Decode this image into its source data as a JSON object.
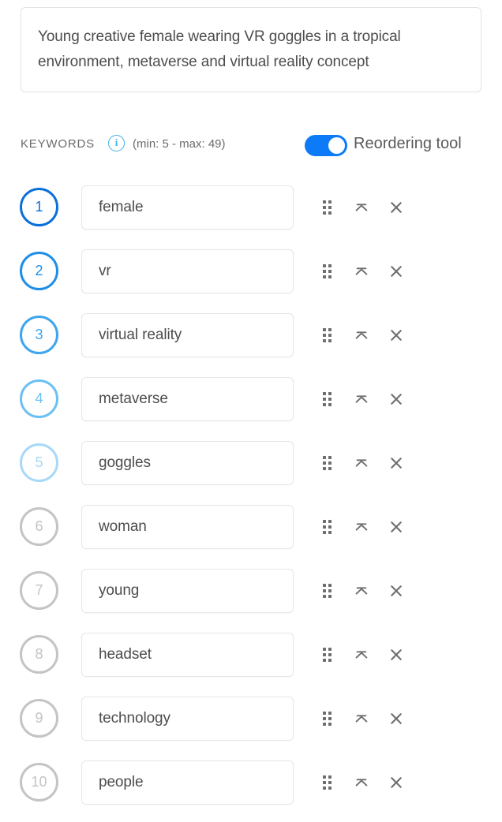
{
  "description": {
    "value": "Young creative female wearing VR goggles in a tropical environment, metaverse and virtual reality concept",
    "placeholder": "Enter description"
  },
  "keywords_header": {
    "label": "KEYWORDS",
    "info_icon": "info-icon",
    "minmax": "(min: 5 - max: 49)",
    "min": 5,
    "max": 49,
    "toggle_label": "Reordering tool",
    "toggle_on": true,
    "toggle_color": "#0d7bf7"
  },
  "row_actions": {
    "drag_label": "drag-handle-icon",
    "move_top_label": "move-to-top-icon",
    "remove_label": "remove-icon"
  },
  "keywords": [
    {
      "index": "1",
      "value": "female",
      "color": "#0a6fd8"
    },
    {
      "index": "2",
      "value": "vr",
      "color": "#1e8ee8"
    },
    {
      "index": "3",
      "value": "virtual reality",
      "color": "#3ea5ee"
    },
    {
      "index": "4",
      "value": "metaverse",
      "color": "#6bc0f3"
    },
    {
      "index": "5",
      "value": "goggles",
      "color": "#a8d9f7"
    },
    {
      "index": "6",
      "value": "woman",
      "color": "#c4c4c4"
    },
    {
      "index": "7",
      "value": "young",
      "color": "#c4c4c4"
    },
    {
      "index": "8",
      "value": "headset",
      "color": "#c4c4c4"
    },
    {
      "index": "9",
      "value": "technology",
      "color": "#c4c4c4"
    },
    {
      "index": "10",
      "value": "people",
      "color": "#c4c4c4"
    }
  ]
}
